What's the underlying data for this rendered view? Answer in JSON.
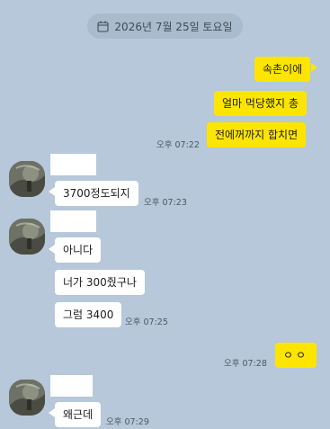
{
  "date_divider": {
    "text": "2026년 7월 25일 토요일",
    "icon": "calendar-icon"
  },
  "messages": {
    "me1": {
      "text": "속촌이에"
    },
    "me2": {
      "text": "얼마 먹당했지 총"
    },
    "me3": {
      "text": "전에꺼까지 합치면",
      "time": "오후 07:22"
    },
    "other1": {
      "text": "3700정도되지",
      "time": "오후 07:23"
    },
    "other2": {
      "text": "아니다"
    },
    "other3": {
      "text": "너가 300줬구나"
    },
    "other4": {
      "text": "그럼 3400",
      "time": "오후 07:25"
    },
    "me4": {
      "text": "ㅇㅇ",
      "time": "오후 07:28"
    },
    "other5": {
      "text": "왜근데",
      "time": "오후 07:29"
    }
  },
  "colors": {
    "background": "#b6c8d9",
    "my_bubble": "#fee500",
    "their_bubble": "#ffffff"
  }
}
